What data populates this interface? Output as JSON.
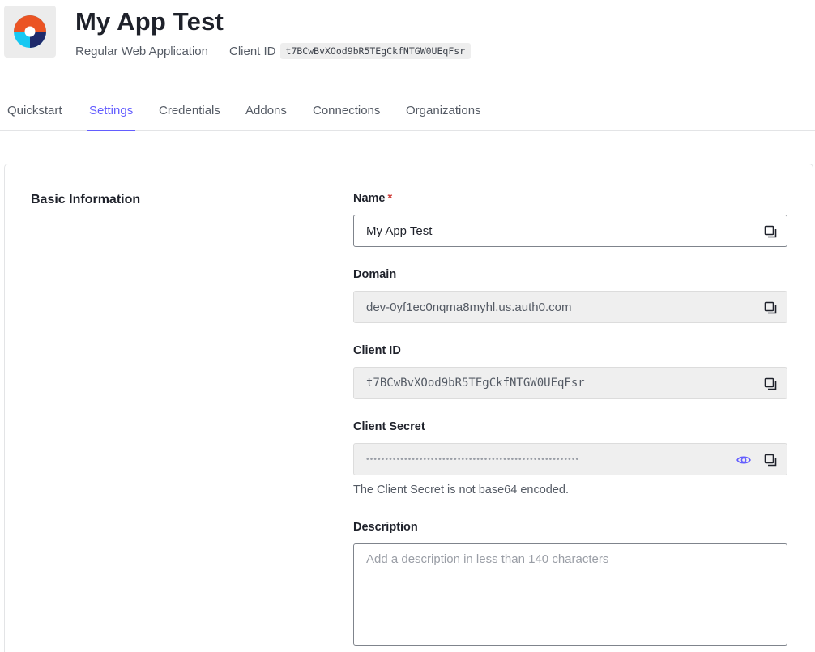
{
  "app": {
    "name": "My App Test",
    "type": "Regular Web Application",
    "client_id_label": "Client ID",
    "client_id": "t7BCwBvXOod9bR5TEgCkfNTGW0UEqFsr",
    "logo_icon": "app-logo-icon"
  },
  "tabs": [
    {
      "label": "Quickstart",
      "active": false
    },
    {
      "label": "Settings",
      "active": true
    },
    {
      "label": "Credentials",
      "active": false
    },
    {
      "label": "Addons",
      "active": false
    },
    {
      "label": "Connections",
      "active": false
    },
    {
      "label": "Organizations",
      "active": false
    }
  ],
  "basic_info": {
    "section_title": "Basic Information",
    "name_field": {
      "label": "Name",
      "required_mark": "*",
      "value": "My App Test"
    },
    "domain_field": {
      "label": "Domain",
      "value": "dev-0yf1ec0nqma8myhl.us.auth0.com"
    },
    "client_id_field": {
      "label": "Client ID",
      "value": "t7BCwBvXOod9bR5TEgCkfNTGW0UEqFsr"
    },
    "client_secret_field": {
      "label": "Client Secret",
      "masked_value": "••••••••••••••••••••••••••••••••••••••••••••••••••••••••",
      "hint": "The Client Secret is not base64 encoded."
    },
    "description_field": {
      "label": "Description",
      "placeholder": "Add a description in less than 140 characters"
    }
  },
  "icons": {
    "copy": "copy-icon",
    "reveal": "eye-icon"
  },
  "colors": {
    "accent": "#635dff",
    "required": "#d03c38",
    "logo_red": "#eb5424",
    "logo_blue": "#16c8f2",
    "logo_navy": "#1f2a6b"
  }
}
